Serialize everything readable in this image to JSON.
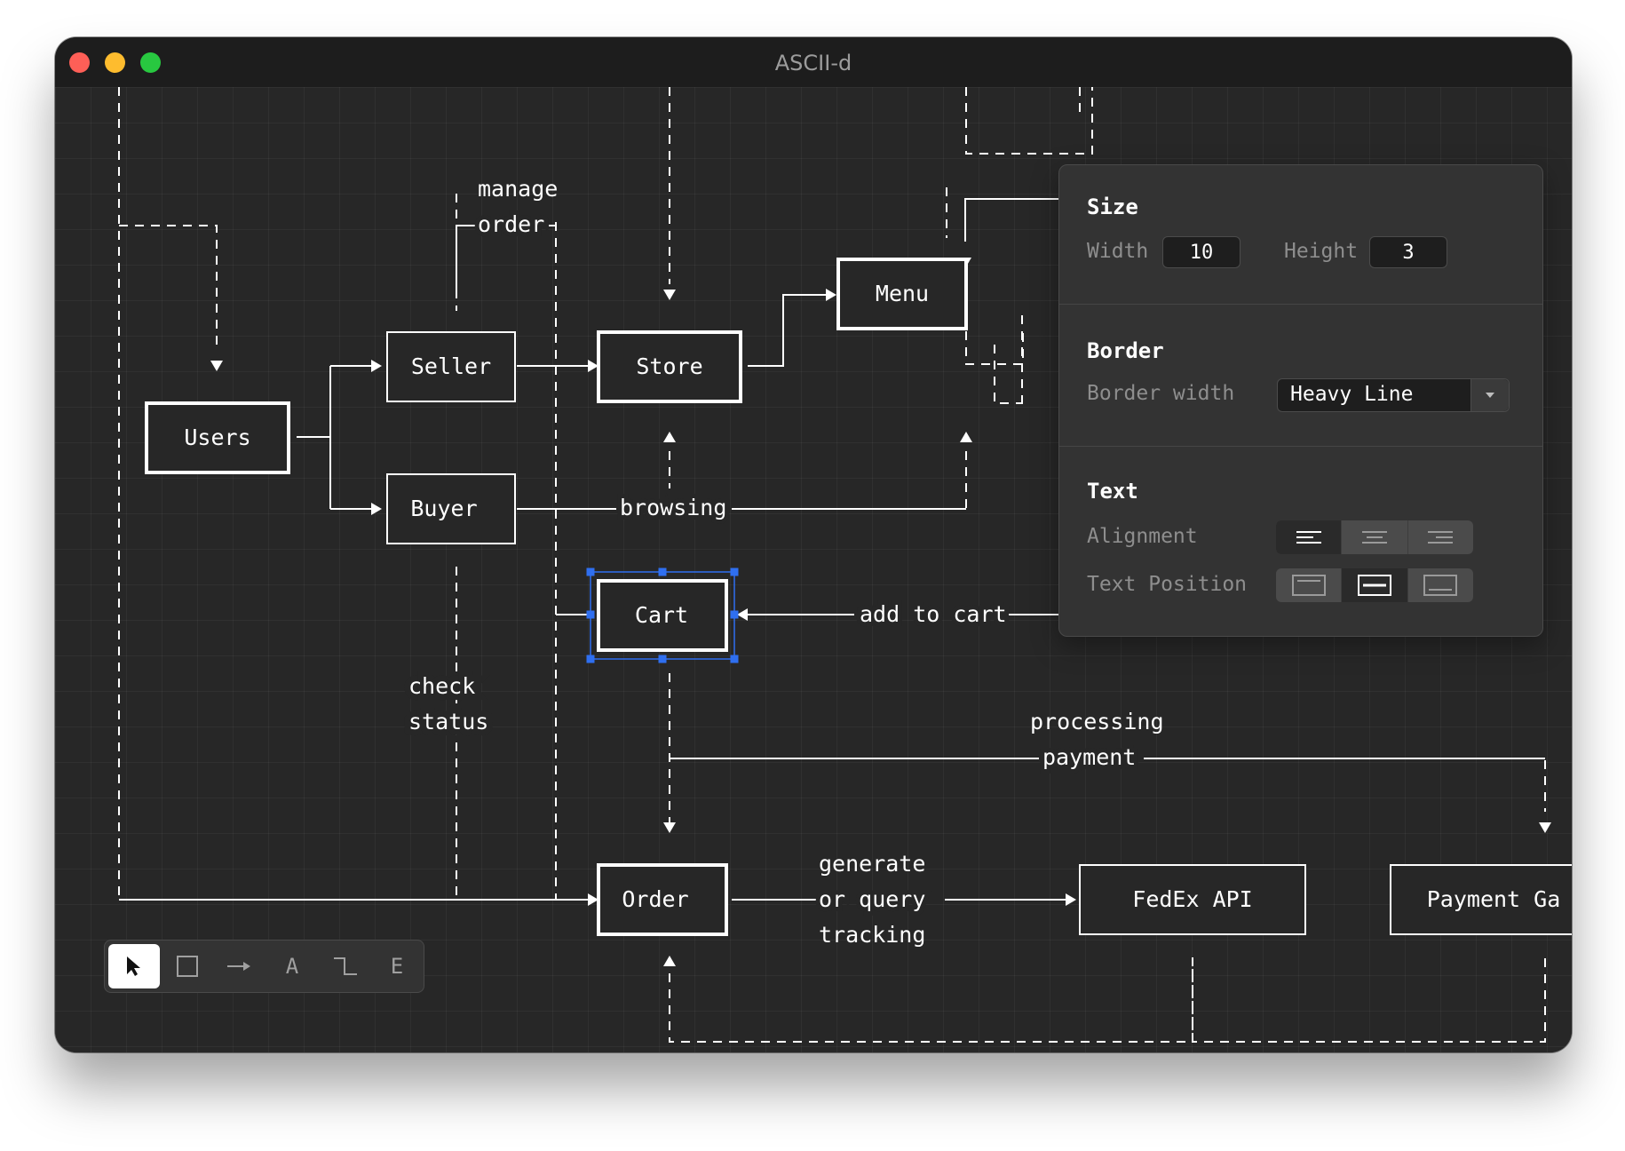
{
  "window": {
    "title": "ASCII-d"
  },
  "diagram": {
    "boxes": {
      "users": "Users",
      "seller": "Seller",
      "buyer": "Buyer",
      "store": "Store",
      "menu": "Menu",
      "cart": "Cart",
      "order": "Order",
      "fedex": "FedEx API",
      "payment": "Payment Ga"
    },
    "labels": {
      "manage": "manage",
      "order": "order",
      "browsing": "browsing",
      "add_to_cart": "add to cart",
      "check": "check",
      "status": "status",
      "processing": "processing",
      "payment": "payment",
      "generate": "generate",
      "or_query": "or query",
      "tracking": "tracking"
    }
  },
  "panel": {
    "size": {
      "title": "Size",
      "width_label": "Width",
      "width_value": "10",
      "height_label": "Height",
      "height_value": "3"
    },
    "border": {
      "title": "Border",
      "width_label": "Border width",
      "width_value": "Heavy Line"
    },
    "text": {
      "title": "Text",
      "alignment_label": "Alignment",
      "position_label": "Text Position",
      "alignment_selected": "left",
      "position_selected": "middle"
    }
  },
  "toolbar": {
    "tools": [
      {
        "name": "select",
        "icon": "cursor-arrow-icon",
        "active": true
      },
      {
        "name": "rectangle",
        "icon": "rectangle-icon"
      },
      {
        "name": "arrow",
        "icon": "arrow-icon"
      },
      {
        "name": "text",
        "label": "A"
      },
      {
        "name": "line",
        "icon": "elbow-line-icon"
      },
      {
        "name": "eraser",
        "label": "E"
      }
    ]
  },
  "colors": {
    "background": "#272727",
    "titlebar": "#1d1d1d",
    "selection": "#2f6ff0",
    "stroke": "#ffffff"
  }
}
